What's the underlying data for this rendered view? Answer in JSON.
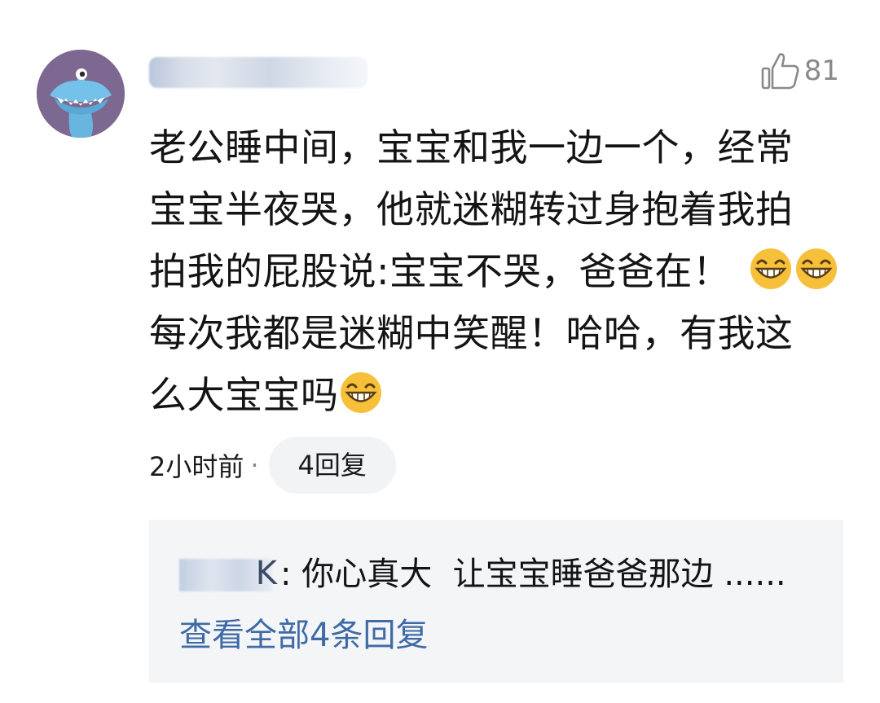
{
  "comment": {
    "avatar_icon": "monster-avatar-icon",
    "username": "",
    "like_count": "81",
    "lines": [
      "老公睡中间，宝宝和我一边一个，经常",
      "宝宝半夜哭，他就迷糊转过身抱着我拍",
      "拍我的屁股说:宝宝不哭，爸爸在！",
      "每次我都是迷糊中笑醒！哈哈，有我这",
      "么大宝宝吗"
    ],
    "time": "2小时前",
    "separator": "·",
    "reply_button": "4回复"
  },
  "replies": {
    "preview_name_tail": "K",
    "preview_separator": ":",
    "preview_text": " 你心真大  让宝宝睡爸爸那边 ......",
    "view_all": "查看全部4条回复"
  },
  "colors": {
    "avatar_bg": "#7d6891",
    "link": "#3f6aa6",
    "reply_bg": "#f3f5f7",
    "muted": "#8a8a8a",
    "emoji": "#f6c03a"
  }
}
